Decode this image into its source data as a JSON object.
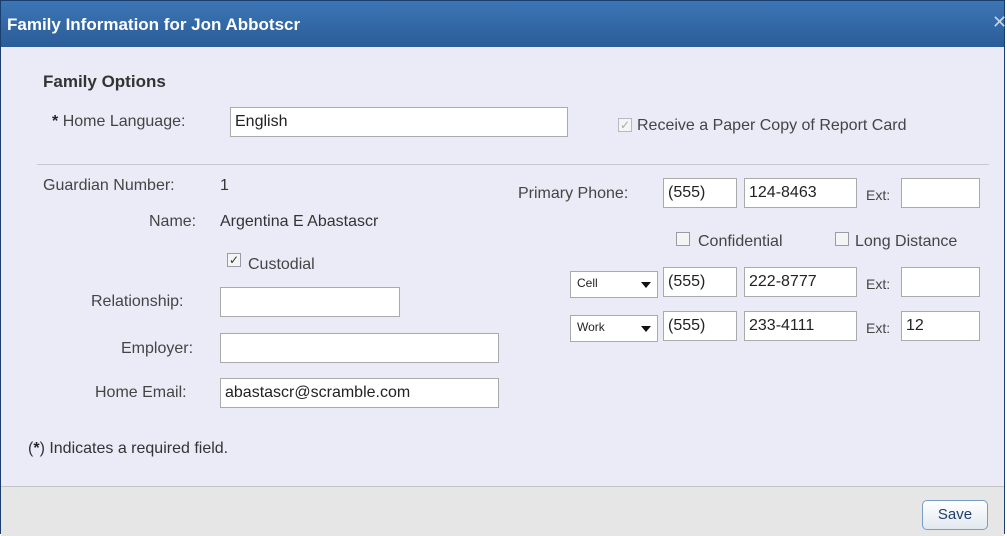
{
  "dialog": {
    "title": "Family Information for Jon Abbotscr",
    "close_glyph": "✕"
  },
  "family_options": {
    "heading": "Family Options",
    "required_marker": "*",
    "home_language_label": "Home Language:",
    "home_language_value": "English",
    "paper_copy_label": "Receive a Paper Copy of Report Card",
    "paper_copy_checked": true,
    "paper_copy_disabled": true
  },
  "guardian": {
    "number_label": "Guardian Number:",
    "number_value": "1",
    "name_label": "Name:",
    "name_value": "Argentina E Abastascr",
    "custodial_label": "Custodial",
    "custodial_checked": true,
    "relationship_label": "Relationship:",
    "relationship_value": "",
    "employer_label": "Employer:",
    "employer_value": "",
    "email_label": "Home Email:",
    "email_value": "abastascr@scramble.com"
  },
  "phones": {
    "primary_label": "Primary Phone:",
    "ext_label": "Ext:",
    "primary": {
      "area": "(555)",
      "number": "124-8463",
      "ext": ""
    },
    "confidential_label": "Confidential",
    "long_distance_label": "Long Distance",
    "confidential_checked": false,
    "long_distance_checked": false,
    "additional": [
      {
        "type": "Cell",
        "area": "(555)",
        "number": "222-8777",
        "ext": ""
      },
      {
        "type": "Work",
        "area": "(555)",
        "number": "233-4111",
        "ext": "12"
      }
    ]
  },
  "note": {
    "open": "(",
    "marker": "*",
    "text": ") Indicates a required field."
  },
  "footer": {
    "save_label": "Save"
  },
  "colors": {
    "titlebar": "#2f64a4",
    "dialog_bg": "#ebebf8",
    "footer_bg": "#e6e6e6"
  }
}
